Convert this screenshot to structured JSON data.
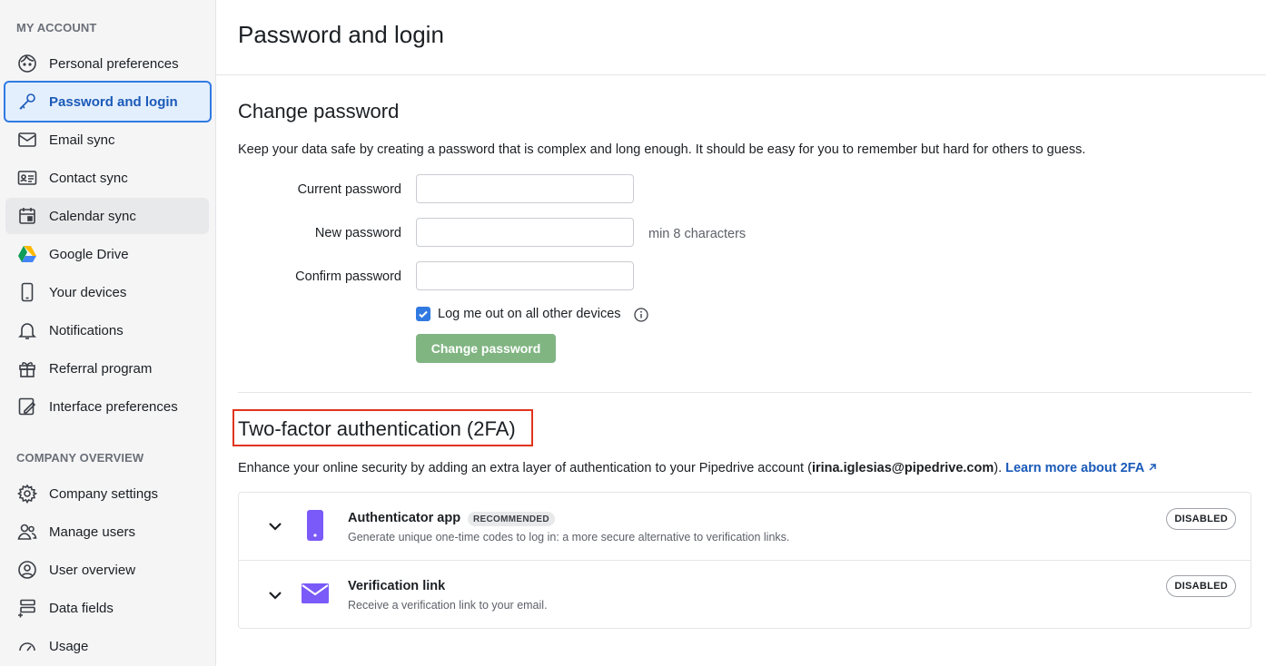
{
  "sidebar": {
    "my_account_heading": "MY ACCOUNT",
    "company_heading": "COMPANY OVERVIEW",
    "items": [
      {
        "label": "Personal preferences",
        "icon": "face-icon"
      },
      {
        "label": "Password and login",
        "icon": "key-icon",
        "state": "active"
      },
      {
        "label": "Email sync",
        "icon": "envelope-icon"
      },
      {
        "label": "Contact sync",
        "icon": "contact-card-icon"
      },
      {
        "label": "Calendar sync",
        "icon": "calendar-icon",
        "state": "hovered"
      },
      {
        "label": "Google Drive",
        "icon": "google-drive-icon"
      },
      {
        "label": "Your devices",
        "icon": "phone-icon"
      },
      {
        "label": "Notifications",
        "icon": "bell-icon"
      },
      {
        "label": "Referral program",
        "icon": "gift-icon"
      },
      {
        "label": "Interface preferences",
        "icon": "interface-edit-icon"
      }
    ],
    "company_items": [
      {
        "label": "Company settings",
        "icon": "gear-icon"
      },
      {
        "label": "Manage users",
        "icon": "users-icon"
      },
      {
        "label": "User overview",
        "icon": "user-circle-icon"
      },
      {
        "label": "Data fields",
        "icon": "data-fields-icon"
      },
      {
        "label": "Usage",
        "icon": "gauge-icon"
      }
    ]
  },
  "main": {
    "page_title": "Password and login",
    "change_password": {
      "heading": "Change password",
      "description": "Keep your data safe by creating a password that is complex and long enough. It should be easy for you to remember but hard for others to guess.",
      "current_label": "Current password",
      "current_value": "",
      "new_label": "New password",
      "new_value": "",
      "new_hint": "min 8 characters",
      "confirm_label": "Confirm password",
      "confirm_value": "",
      "logout_label": "Log me out on all other devices",
      "logout_checked": true,
      "button_label": "Change password"
    },
    "two_factor": {
      "heading": "Two-factor authentication (2FA)",
      "description_prefix": "Enhance your online security by adding an extra layer of authentication to your Pipedrive account (",
      "email": "irina.iglesias@pipedrive.com",
      "description_suffix": ").",
      "learn_more": "Learn more about 2FA",
      "methods": [
        {
          "title": "Authenticator app",
          "badge": "RECOMMENDED",
          "subtitle": "Generate unique one-time codes to log in: a more secure alternative to verification links.",
          "status": "DISABLED",
          "icon": "smartphone-icon"
        },
        {
          "title": "Verification link",
          "subtitle": "Receive a verification link to your email.",
          "status": "DISABLED",
          "icon": "mail-icon"
        }
      ]
    }
  },
  "colors": {
    "accent": "#317ae2",
    "active_bg": "#e4effd",
    "button_disabled_green": "#80b582",
    "highlight_red": "#e0341c",
    "method_icon_purple": "#7a5af8"
  }
}
